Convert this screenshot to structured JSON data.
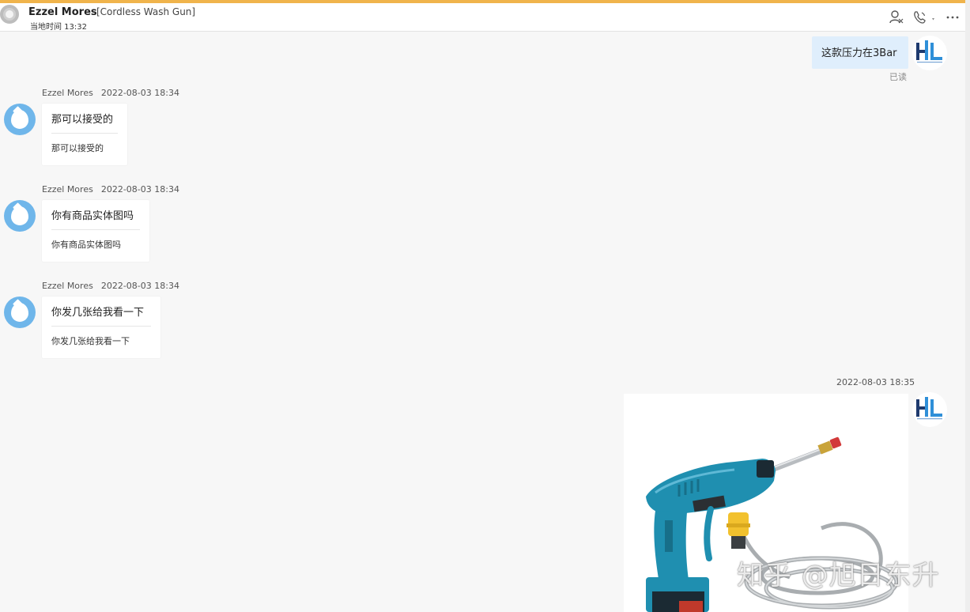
{
  "header": {
    "contact_name": "Ezzel Mores",
    "topic": "[Cordless Wash Gun]",
    "local_time": "当地时间 13:32",
    "icons": [
      "contact-card-icon",
      "phone-icon",
      "more-icon"
    ]
  },
  "outgoing_top": {
    "text": "这款压力在3Bar",
    "status": "已读"
  },
  "incoming": [
    {
      "sender": "Ezzel Mores",
      "time": "2022-08-03 18:34",
      "text": "那可以接受的",
      "translation": "那可以接受的"
    },
    {
      "sender": "Ezzel Mores",
      "time": "2022-08-03 18:34",
      "text": "你有商品实体图吗",
      "translation": "你有商品实体图吗"
    },
    {
      "sender": "Ezzel Mores",
      "time": "2022-08-03 18:34",
      "text": "你发几张给我看一下",
      "translation": "你发几张给我看一下"
    }
  ],
  "outgoing_image": {
    "time": "2022-08-03 18:35",
    "image": "cordless-wash-gun-photo",
    "logo_text": "HL"
  },
  "watermark": "知乎 @旭日东升",
  "colors": {
    "accent": "#f0b44c",
    "outgoing_bubble": "#dfeefc",
    "avatar_blue": "#6fb6ea",
    "logo_navy": "#1e3a6e",
    "logo_blue": "#2f8fd8",
    "gun_teal": "#1f8fb0"
  }
}
